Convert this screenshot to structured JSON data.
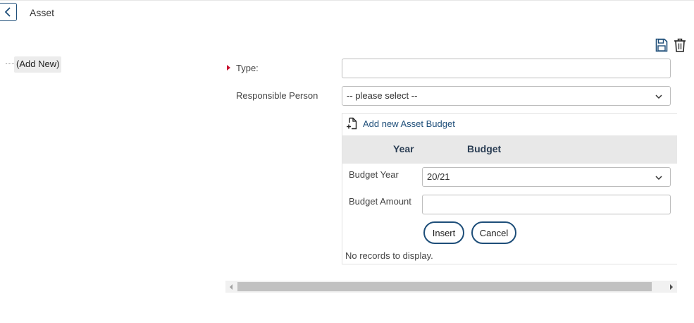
{
  "header": {
    "title": "Asset",
    "back_icon": "chevron-left-icon"
  },
  "toolbar": {
    "save_icon": "save-icon",
    "delete_icon": "trash-icon"
  },
  "tree": {
    "items": [
      {
        "label": "(Add New)"
      }
    ]
  },
  "form": {
    "type_label": "Type:",
    "type_value": "",
    "responsible_person_label": "Responsible Person",
    "responsible_person_value": "-- please select --"
  },
  "budget": {
    "add_label": "Add new Asset Budget",
    "columns": [
      "Year",
      "Budget"
    ],
    "edit": {
      "year_label": "Budget Year",
      "year_value": "20/21",
      "amount_label": "Budget Amount",
      "amount_value": "",
      "insert_label": "Insert",
      "cancel_label": "Cancel"
    },
    "empty_text": "No records to display."
  },
  "colors": {
    "accent": "#1e4e79",
    "required": "#c8102e",
    "grid_header": "#e8e8e8"
  }
}
